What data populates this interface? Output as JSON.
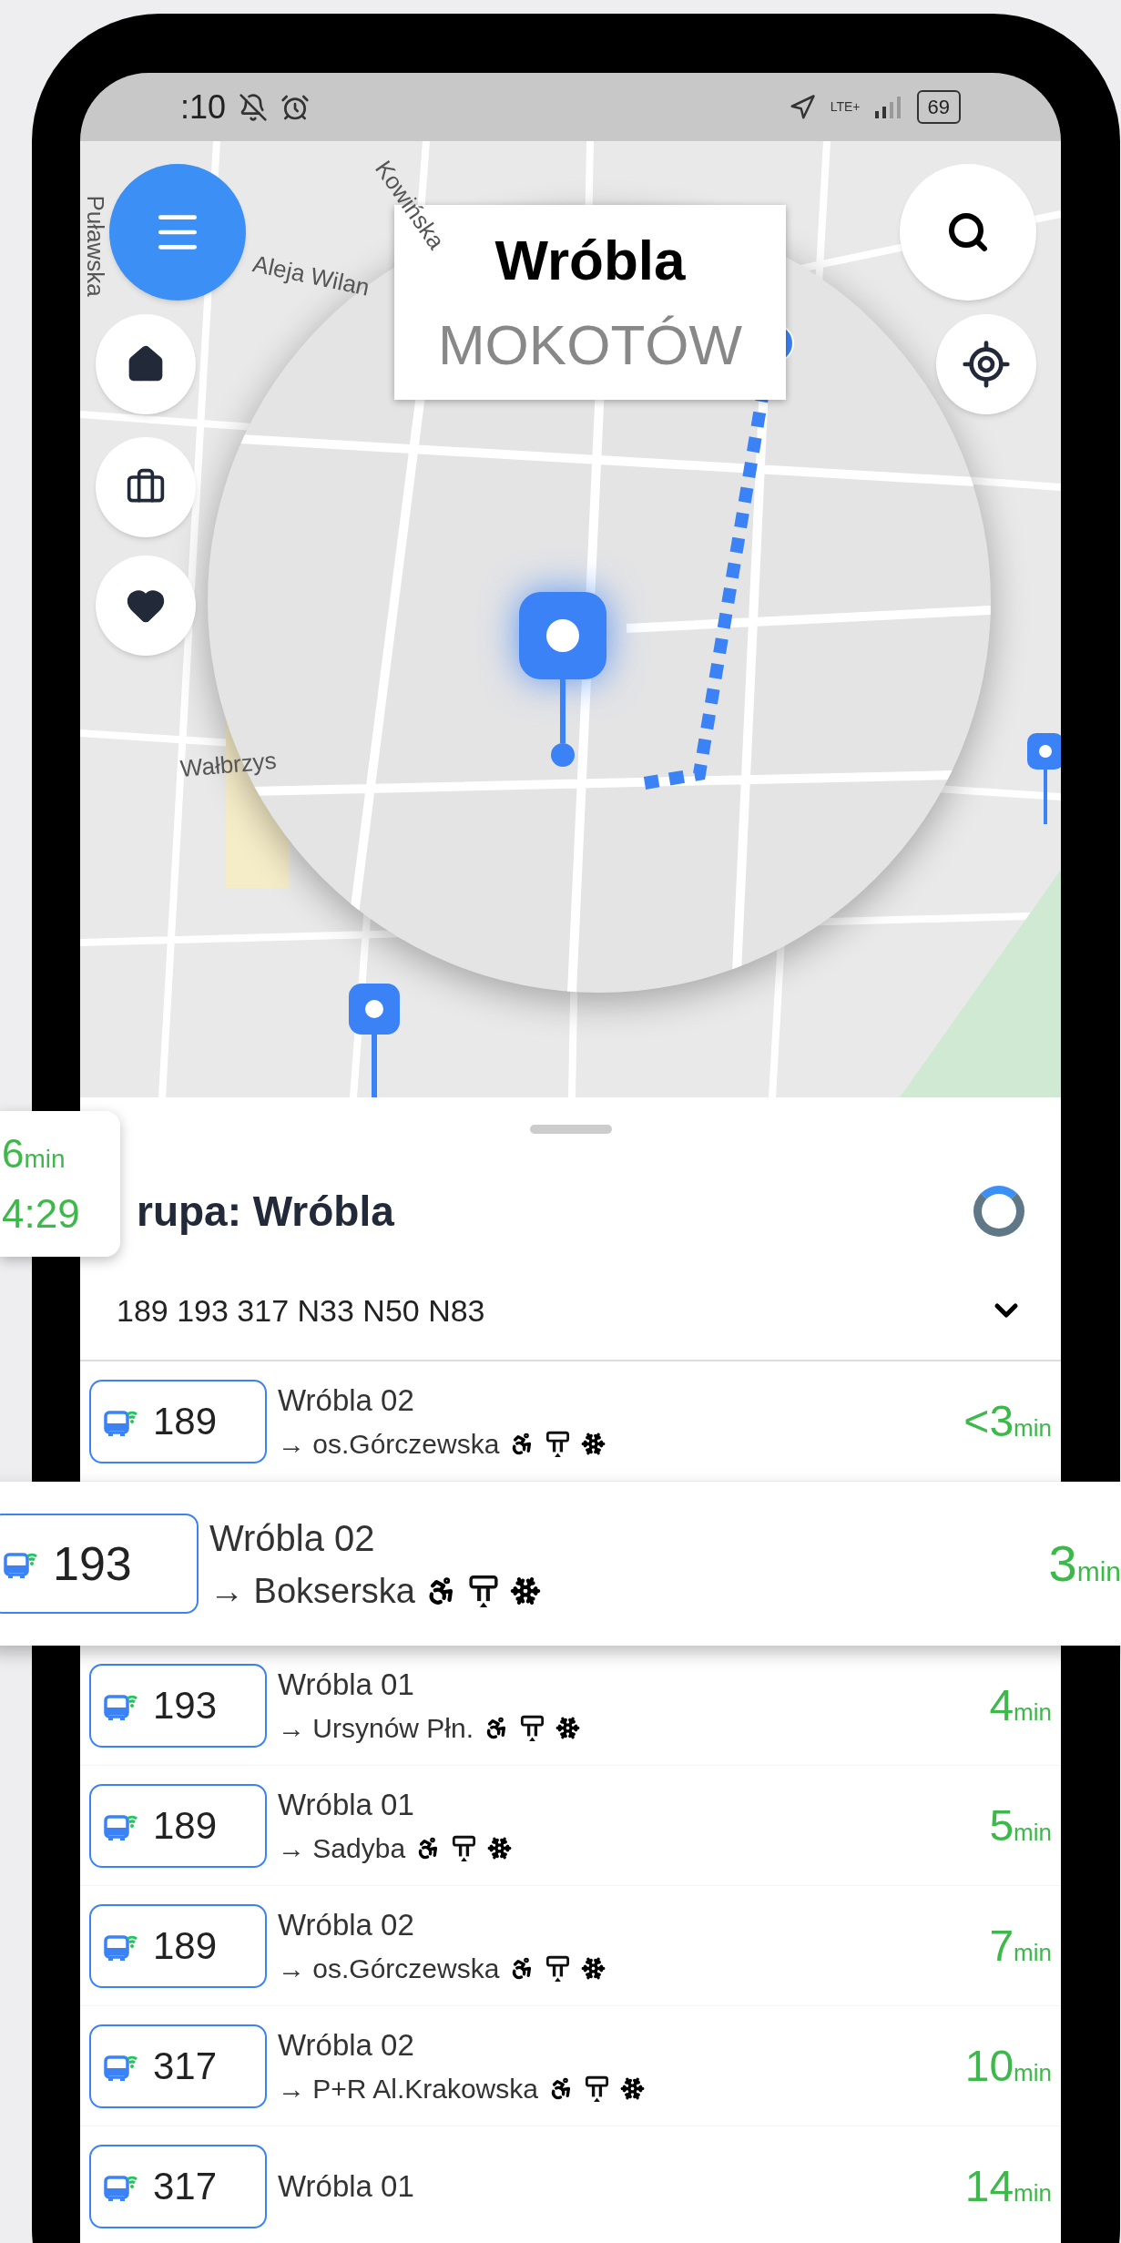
{
  "status_bar": {
    "time": ":10",
    "network": "LTE+",
    "battery": "69"
  },
  "map": {
    "street_labels": [
      "Kowińska",
      "Aleja Wilan",
      "Puławska",
      "Wałbrzys"
    ],
    "callout": {
      "title": "Wróbla",
      "subtitle": "MOKOTÓW"
    }
  },
  "side_card": {
    "minutes": "6",
    "unit": "min",
    "time": "4:29"
  },
  "sheet": {
    "title": "rupa: Wróbla",
    "lines": "189 193 317 N33 N50 N83"
  },
  "departures": [
    {
      "line": "189",
      "stop": "Wróbla 02",
      "direction": "→ os.Górczewska",
      "minutes": "<3",
      "unit": "min",
      "selected": false
    },
    {
      "line": "193",
      "stop": "Wróbla 02",
      "direction": "→ Bokserska",
      "minutes": "3",
      "unit": "min",
      "selected": true
    },
    {
      "line": "193",
      "stop": "Wróbla 01",
      "direction": "→ Ursynów Płn.",
      "minutes": "4",
      "unit": "min",
      "selected": false
    },
    {
      "line": "189",
      "stop": "Wróbla 01",
      "direction": "→ Sadyba",
      "minutes": "5",
      "unit": "min",
      "selected": false
    },
    {
      "line": "189",
      "stop": "Wróbla 02",
      "direction": "→ os.Górczewska",
      "minutes": "7",
      "unit": "min",
      "selected": false
    },
    {
      "line": "317",
      "stop": "Wróbla 02",
      "direction": "→ P+R Al.Krakowska",
      "minutes": "10",
      "unit": "min",
      "selected": false
    },
    {
      "line": "317",
      "stop": "Wróbla 01",
      "minutes": "14",
      "unit": "min",
      "selected": false
    }
  ]
}
